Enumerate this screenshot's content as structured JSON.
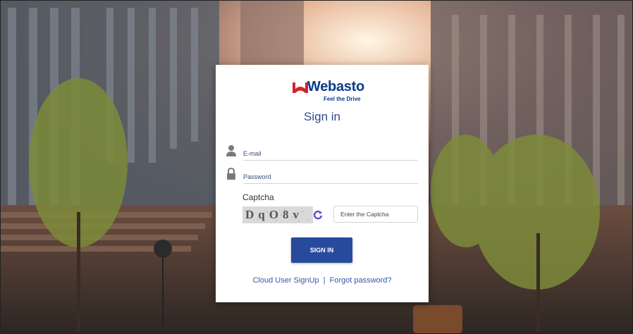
{
  "logo": {
    "brand": "Webasto",
    "tagline": "Feel the Drive",
    "icon": "webasto-logo"
  },
  "form": {
    "title": "Sign in",
    "email_placeholder": "E-mail",
    "email_icon": "user-icon",
    "password_placeholder": "Password",
    "password_icon": "lock-icon",
    "captcha_label": "Captcha",
    "captcha_text": "DqO8v",
    "captcha_refresh_icon": "refresh-icon",
    "captcha_placeholder": "Enter the Captcha",
    "submit_label": "SIGN IN"
  },
  "links": {
    "signup": "Cloud User SignUp",
    "separator": "|",
    "forgot": "Forgot password?"
  },
  "colors": {
    "brand_blue": "#274a9c",
    "link_blue": "#3658a6",
    "card_bg": "#ffffff"
  }
}
